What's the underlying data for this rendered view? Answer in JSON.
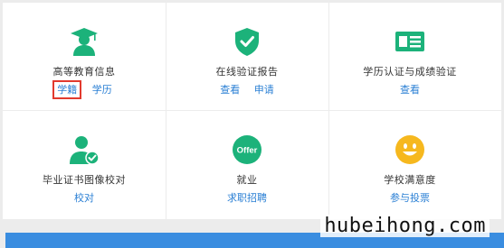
{
  "colors": {
    "accent_green": "#1cb27a",
    "link_blue": "#2a7fd4",
    "highlight_red": "#e23a2e",
    "bar_blue": "#3a8de0",
    "smile_yellow": "#f6b81e"
  },
  "grid": {
    "row1": [
      {
        "icon": "graduate-icon",
        "title": "高等教育信息",
        "links": [
          "学籍",
          "学历"
        ]
      },
      {
        "icon": "shield-check-icon",
        "title": "在线验证报告",
        "links": [
          "查看",
          "申请"
        ]
      },
      {
        "icon": "id-card-icon",
        "title": "学历认证与成绩验证",
        "links": [
          "查看"
        ]
      }
    ],
    "row2": [
      {
        "icon": "user-verified-icon",
        "title": "毕业证书图像校对",
        "links": [
          "校对"
        ]
      },
      {
        "icon": "offer-icon",
        "title": "就业",
        "links": [
          "求职招聘"
        ],
        "badge": "Offer"
      },
      {
        "icon": "smiley-icon",
        "title": "学校满意度",
        "links": [
          "参与投票"
        ]
      }
    ]
  },
  "watermark": "hubeihong.com"
}
